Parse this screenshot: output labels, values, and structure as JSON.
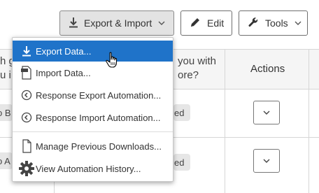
{
  "toolbar": {
    "export_import_label": "Export & Import",
    "edit_label": "Edit",
    "tools_label": "Tools"
  },
  "table": {
    "header_left_fragments": [
      "h g",
      "u i"
    ],
    "header_mid_fragments": [
      "you with",
      "ore?"
    ],
    "actions_header": "Actions",
    "rows": [
      {
        "left_tag": "o B",
        "status": "ed"
      },
      {
        "left_tag": "o A",
        "status": "ed"
      }
    ]
  },
  "menu": {
    "items": [
      {
        "label": "Export Data...",
        "icon": "download-icon",
        "active": true
      },
      {
        "label": "Import Data...",
        "icon": "csv-file-icon"
      },
      {
        "label": "Response Export Automation...",
        "icon": "circle-arrow-icon"
      },
      {
        "label": "Response Import Automation...",
        "icon": "circle-arrow-icon"
      },
      {
        "label": "Manage Previous Downloads...",
        "icon": "document-icon"
      },
      {
        "label": "View Automation History...",
        "icon": "gear-icon"
      }
    ]
  },
  "colors": {
    "active_item": "#1f73c9",
    "export_button_bg": "#e3e3e3",
    "header_bg": "#f5f5f5"
  }
}
